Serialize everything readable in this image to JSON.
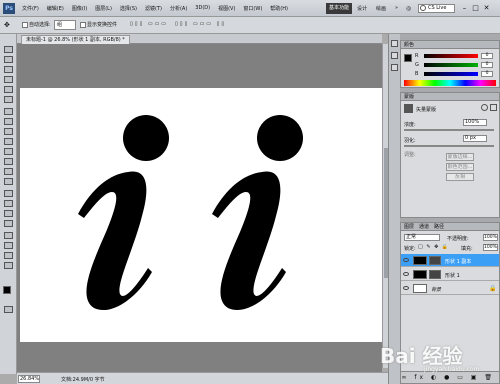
{
  "app": {
    "logo": "Ps"
  },
  "menu": [
    "文件(F)",
    "编辑(E)",
    "图像(I)",
    "图层(L)",
    "选择(S)",
    "滤镜(T)",
    "分析(A)",
    "3D(D)",
    "视图(V)",
    "窗口(W)",
    "帮助(H)"
  ],
  "titlebar": {
    "br": "Br",
    "zoom": "33.3",
    "workspace": "基本功能",
    "ws2": "设计",
    "ws3": "绘画",
    "more": "»",
    "search": "CS Live"
  },
  "options": {
    "auto_select": "自动选择:",
    "auto_value": "组",
    "transform": "显示变换控件"
  },
  "document": {
    "tab": "未标题-1 @ 26.8% (形状 1 副本, RGB/8) *"
  },
  "status": {
    "zoom": "26.84%",
    "info": "文档:24.9M/0 字节"
  },
  "color_panel": {
    "title": "颜色",
    "rows": [
      {
        "label": "R",
        "value": "0",
        "gradient": "#ff0000"
      },
      {
        "label": "G",
        "value": "0",
        "gradient": "#00b000"
      },
      {
        "label": "B",
        "value": "0",
        "gradient": "#0000ff"
      }
    ]
  },
  "adjust_panel": {
    "title": "蒙版",
    "subtitle": "矢量蒙版",
    "density_label": "浓度:",
    "density_value": "100%",
    "feather_label": "羽化:",
    "feather_value": "0 px",
    "refine": "调整:",
    "btn_edge": "蒙版边缘...",
    "btn_range": "颜色范围...",
    "btn_invert": "反相"
  },
  "layers_panel": {
    "tabs": [
      "图层",
      "通道",
      "路径"
    ],
    "blend": "正常",
    "opacity_label": "不透明度:",
    "opacity_value": "100%",
    "lock_label": "锁定:",
    "fill_label": "填充:",
    "fill_value": "100%",
    "layers": [
      {
        "name": "形状 1 副本",
        "selected": true
      },
      {
        "name": "形状 1",
        "selected": false
      },
      {
        "name": "背景",
        "selected": false
      }
    ]
  },
  "watermark": {
    "text": "Bai 经验",
    "sub": "jingyan.baidu.com"
  },
  "colors": {
    "accent": "#3399ff",
    "selected_layer": "#3ba0f5"
  }
}
